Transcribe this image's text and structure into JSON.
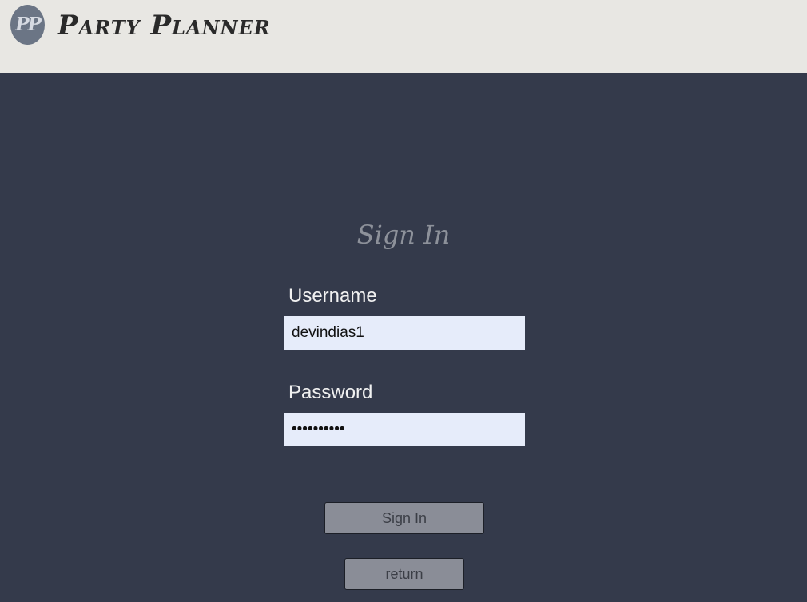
{
  "header": {
    "logo_text": "PP",
    "app_title": "Party Planner"
  },
  "signin": {
    "heading": "Sign In",
    "username_label": "Username",
    "username_value": "devindias1",
    "password_label": "Password",
    "password_value": "••••••••••",
    "submit_label": "Sign In",
    "return_label": "return"
  },
  "colors": {
    "header_bg": "#e8e7e3",
    "main_bg": "#343a4b",
    "input_bg": "#e6ecfa",
    "button_bg": "#8a8d97"
  },
  "icons": {
    "logo": "pp-logo-icon"
  }
}
